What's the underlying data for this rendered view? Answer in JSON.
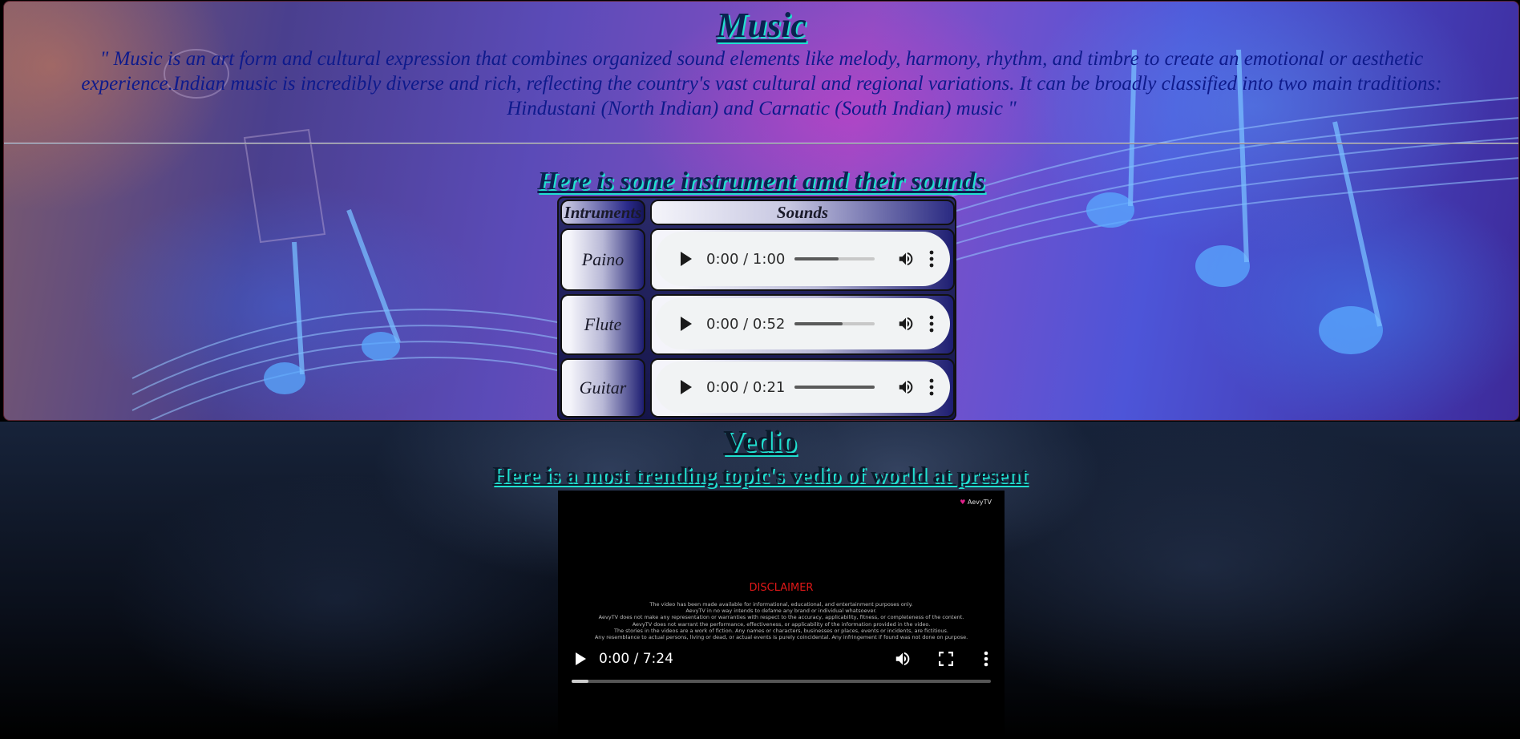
{
  "music": {
    "title": "Music",
    "quote": "\" Music is an art form and cultural expression that combines organized sound elements like melody, harmony, rhythm, and timbre to create an emotional or aesthetic experience.Indian music is incredibly diverse and rich, reflecting the country's vast cultural and regional variations. It can be broadly classified into two main traditions: Hindustani (North Indian) and Carnatic (South Indian) music \"",
    "section_heading": "Here is some instrument amd their sounds",
    "table": {
      "headers": [
        "Intruments",
        "Sounds"
      ],
      "rows": [
        {
          "instrument": "Paino",
          "time": "0:00 / 1:00",
          "volume": 0.55
        },
        {
          "instrument": "Flute",
          "time": "0:00 / 0:52",
          "volume": 0.6
        },
        {
          "instrument": "Guitar",
          "time": "0:00 / 0:21",
          "volume": 1.0
        }
      ]
    }
  },
  "video": {
    "title": "Vedio",
    "subtitle": "Here is a most trending topic's vedio of world at present",
    "brand": "AevyTV",
    "disclaimer_title": "DISCLAIMER",
    "disclaimer_lines": [
      "The video has been made available for informational, educational, and entertainment purposes only.",
      "AevyTV in no way intends to defame any brand or individual whatsoever.",
      "AevyTV does not make any representation or warranties with respect to the accuracy, applicability, fitness, or completeness of the content.",
      "AevyTV does not warrant the performance, effectiveness, or applicability of the information provided in the video.",
      "The stories in the videos are a work of fiction. Any names or characters, businesses or places, events or incidents, are fictitious.",
      "Any resemblance to actual persons, living or dead, or actual events is purely coincidental. Any infringement if found was not done on purpose."
    ],
    "time": "0:00 / 7:24",
    "progress": 0.04
  },
  "colors": {
    "heading_shadow": "#20e0d0",
    "heading_text": "#0b2250",
    "quote_text": "#0e1a8c",
    "disclaimer_red": "#e01818"
  }
}
